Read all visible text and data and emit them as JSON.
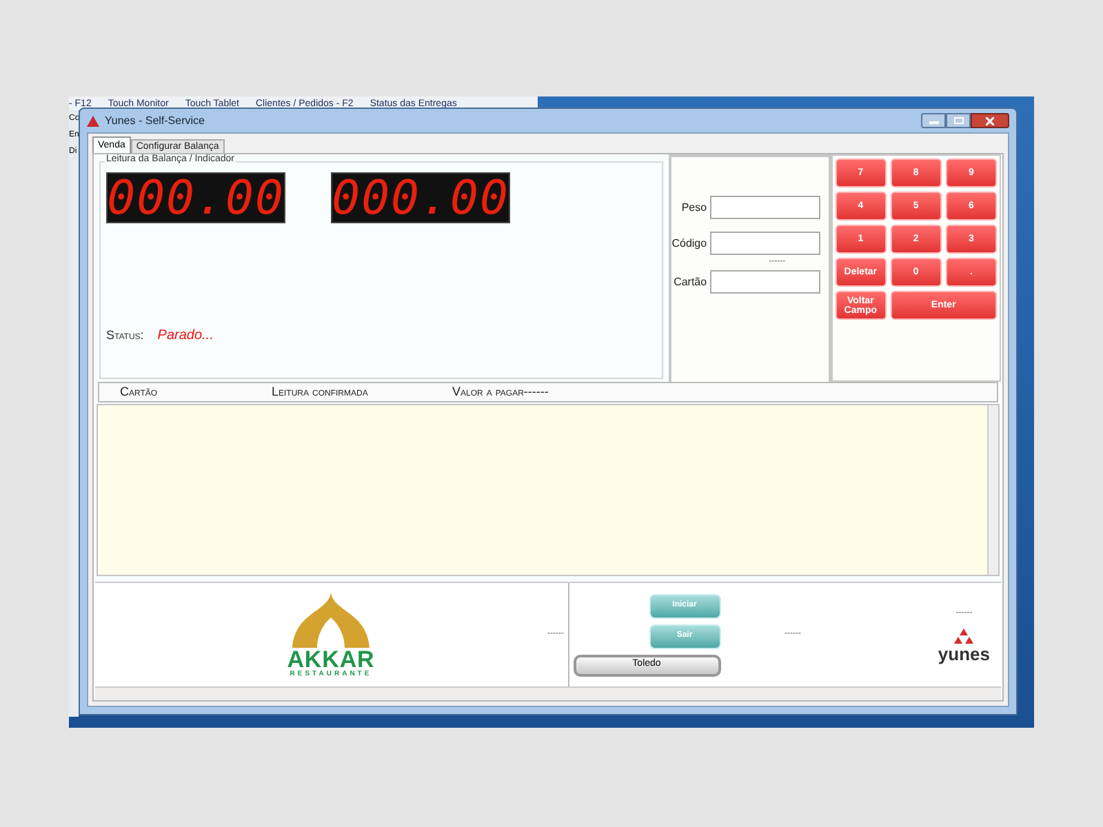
{
  "background_app": {
    "toolbar": [
      "- F12",
      "Touch Monitor",
      "Touch Tablet",
      "Clientes / Pedidos - F2",
      "Status das Entregas"
    ],
    "side_labels": [
      "Co",
      "En",
      "Di"
    ]
  },
  "window": {
    "title": "Yunes - Self-Service"
  },
  "tabs": [
    {
      "label": "Venda",
      "selected": true
    },
    {
      "label": "Configurar Balança",
      "selected": false
    }
  ],
  "scale_group": {
    "title": "Leitura da Balança / Indicador",
    "displays": [
      "000.00",
      "000.00"
    ],
    "status_label": "Status:",
    "status_value": "Parado..."
  },
  "fields": [
    {
      "label": "Peso"
    },
    {
      "label": "Código",
      "note": "------"
    },
    {
      "label": "Cartão"
    }
  ],
  "keypad": [
    {
      "label": "7",
      "kind": "key"
    },
    {
      "label": "8",
      "kind": "key"
    },
    {
      "label": "9",
      "kind": "key"
    },
    {
      "label": "4",
      "kind": "key"
    },
    {
      "label": "5",
      "kind": "key"
    },
    {
      "label": "6",
      "kind": "key"
    },
    {
      "label": "1",
      "kind": "key"
    },
    {
      "label": "2",
      "kind": "key"
    },
    {
      "label": "3",
      "kind": "key"
    },
    {
      "label": "Deletar",
      "kind": "key"
    },
    {
      "label": "0",
      "kind": "key"
    },
    {
      "label": ".",
      "kind": "key"
    },
    {
      "label": "Voltar Campo",
      "kind": "key"
    },
    {
      "label": "Enter",
      "kind": "wide"
    }
  ],
  "list": {
    "columns": [
      "Cartão",
      "Leitura confirmada",
      "Valor a pagar------"
    ]
  },
  "footer": {
    "logo": {
      "name": "AKKAR",
      "tagline": "RESTAURANTE"
    },
    "dash_left": "------",
    "buttons": [
      {
        "label": "Iniciar",
        "kind": "teal"
      },
      {
        "label": "Sair",
        "kind": "teal"
      },
      {
        "label": "Toledo",
        "kind": "silver"
      }
    ],
    "dash_middle": "------",
    "dash_right": "------",
    "brand": "yunes"
  }
}
